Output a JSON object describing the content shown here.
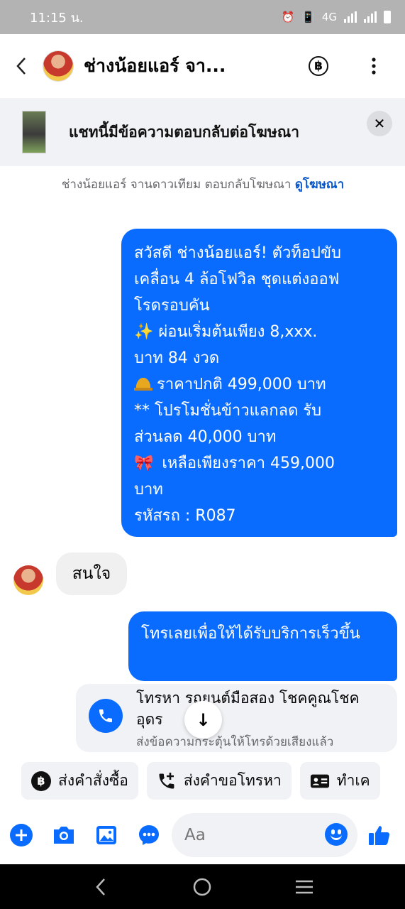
{
  "status_bar": {
    "time": "11:15 น.",
    "network": "4G"
  },
  "header": {
    "contact_name": "ช่างน้อยแอร์ จา...",
    "baht_symbol": "฿"
  },
  "ad_banner": {
    "text": "แชทนี้มีข้อความตอบกลับต่อโฆษณา",
    "close_symbol": "✕"
  },
  "notice": {
    "text": "ช่างน้อยแอร์ จานดาวเทียม ตอบกลับโฆษณา ",
    "link": "ดูโฆษณา"
  },
  "messages": {
    "msg1_lines": [
      "สวัสดี ช่างน้อยแอร์! ตัวท็อปขับ",
      "เคลื่อน 4 ล้อโฟวิล ชุดแต่งออฟ",
      "โรดรอบคัน",
      "✨  ผ่อนเริ่มต้นเพียง 8,xxx.",
      "บาท 84 งวด",
      "ราคาปกติ 499,000 บาท",
      "** โปรโมชั่นข้าวแลกลด รับ",
      "ส่วนลด 40,000 บาท",
      "เหลือเพียงราคา 459,000",
      "บาท",
      " รหัสรถ : R087"
    ],
    "bow_emoji": "🎀",
    "reply": "สนใจ",
    "msg2": "โทรเลยเพื่อให้ได้รับบริการเร็วขึ้น"
  },
  "call_card": {
    "title": "โทรหา รถยนต์มือสอง โชคคูณโชคอุดร",
    "subtitle": "ส่งข้อความกระตุ้นให้โทรด้วยเสียงแล้ว"
  },
  "scroll_arrow": "↓",
  "quick_actions": [
    {
      "label": "ส่งคำสั่งซื้อ",
      "icon": "baht-icon",
      "glyph": "฿"
    },
    {
      "label": "ส่งคำขอโทรหา",
      "icon": "phone-plus-icon"
    },
    {
      "label": "ทำเค",
      "icon": "id-card-icon"
    }
  ],
  "composer": {
    "placeholder": "Aa"
  },
  "colors": {
    "messenger_blue": "#0a6cff",
    "bubble_gray": "#f0f0f0"
  }
}
